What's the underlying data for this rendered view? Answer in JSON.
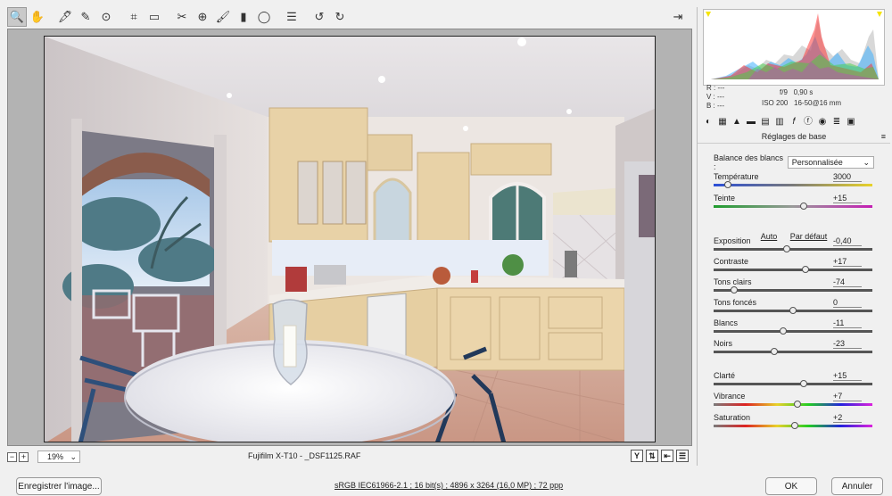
{
  "toolbar": {
    "tools": [
      {
        "name": "zoom-tool",
        "icon": "zoom-icon",
        "glyph": "🔍",
        "active": true
      },
      {
        "name": "hand-tool",
        "icon": "hand-icon",
        "glyph": "✋",
        "active": false
      },
      {
        "name": "white-balance-tool",
        "icon": "eyedropper-icon",
        "glyph": "🖋",
        "active": false
      },
      {
        "name": "color-sampler-tool",
        "icon": "color-sampler-icon",
        "glyph": "✎",
        "active": false
      },
      {
        "name": "target-adjustment-tool",
        "icon": "target-icon",
        "glyph": "⊙",
        "active": false
      },
      {
        "name": "crop-tool",
        "icon": "crop-icon",
        "glyph": "⌗",
        "active": false
      },
      {
        "name": "straighten-tool",
        "icon": "straighten-icon",
        "glyph": "▭",
        "active": false
      },
      {
        "name": "spot-removal-tool",
        "icon": "spot-removal-icon",
        "glyph": "✂",
        "active": false
      },
      {
        "name": "red-eye-tool",
        "icon": "red-eye-icon",
        "glyph": "⊕",
        "active": false
      },
      {
        "name": "adjustment-brush-tool",
        "icon": "brush-icon",
        "glyph": "🖌",
        "active": false
      },
      {
        "name": "graduated-filter-tool",
        "icon": "graduated-filter-icon",
        "glyph": "▮",
        "active": false
      },
      {
        "name": "radial-filter-tool",
        "icon": "radial-filter-icon",
        "glyph": "◯",
        "active": false
      },
      {
        "name": "preferences-tool",
        "icon": "list-icon",
        "glyph": "☰",
        "active": false
      },
      {
        "name": "rotate-left-tool",
        "icon": "rotate-left-icon",
        "glyph": "↺",
        "active": false
      },
      {
        "name": "rotate-right-tool",
        "icon": "rotate-right-icon",
        "glyph": "↻",
        "active": false
      }
    ],
    "exit_icon": "fullscreen-exit-icon",
    "exit_glyph": "⇥"
  },
  "preview": {
    "zoom": "19%",
    "filename": "Fujifilm X-T10  -  _DSF1125.RAF",
    "minus_glyph": "−",
    "plus_glyph": "+",
    "view_buttons": [
      {
        "name": "before-after-y-button",
        "glyph": "Y"
      },
      {
        "name": "before-after-swap-button",
        "glyph": "⇅"
      },
      {
        "name": "copy-settings-button",
        "glyph": "⇤"
      },
      {
        "name": "toggle-defaults-button",
        "glyph": "☰"
      }
    ]
  },
  "info": {
    "r_label": "R :",
    "r_value": "---",
    "v_label": "V :",
    "v_value": "---",
    "b_label": "B :",
    "b_value": "---",
    "aperture": "f/9",
    "shutter": "0,90 s",
    "iso": "ISO 200",
    "lens": "16-50@16 mm"
  },
  "panel": {
    "tabs": [
      "◐",
      "▦",
      "▲",
      "▬",
      "▤",
      "▥",
      "𝑓",
      "ⓕ",
      "◉",
      "≣",
      "▣"
    ],
    "title": "Réglages de base",
    "menu_glyph": "≡",
    "white_balance_label": "Balance des blancs :",
    "white_balance_value": "Personnalisée",
    "auto_label": "Auto",
    "default_label": "Par défaut",
    "sliders": [
      {
        "key": "temperature",
        "label": "Température",
        "value": "3000",
        "pos": 0.09,
        "track": "temp"
      },
      {
        "key": "tint",
        "label": "Teinte",
        "value": "+15",
        "pos": 0.57,
        "track": "tint"
      },
      {
        "key": "exposure",
        "label": "Exposition",
        "value": "-0,40",
        "pos": 0.46,
        "track": "plain"
      },
      {
        "key": "contrast",
        "label": "Contraste",
        "value": "+17",
        "pos": 0.58,
        "track": "plain"
      },
      {
        "key": "highlights",
        "label": "Tons clairs",
        "value": "-74",
        "pos": 0.13,
        "track": "plain"
      },
      {
        "key": "shadows",
        "label": "Tons foncés",
        "value": "0",
        "pos": 0.5,
        "track": "plain"
      },
      {
        "key": "whites",
        "label": "Blancs",
        "value": "-11",
        "pos": 0.44,
        "track": "plain"
      },
      {
        "key": "blacks",
        "label": "Noirs",
        "value": "-23",
        "pos": 0.38,
        "track": "plain"
      },
      {
        "key": "clarity",
        "label": "Clarté",
        "value": "+15",
        "pos": 0.57,
        "track": "plain"
      },
      {
        "key": "vibrance",
        "label": "Vibrance",
        "value": "+7",
        "pos": 0.53,
        "track": "sat"
      },
      {
        "key": "saturation",
        "label": "Saturation",
        "value": "+2",
        "pos": 0.51,
        "track": "sat"
      }
    ]
  },
  "bottom": {
    "save_label": "Enregistrer l'image...",
    "workflow_label": "sRGB IEC61966-2.1 ; 16 bit(s) ; 4896 x 3264 (16,0 MP) ; 72 ppp",
    "ok_label": "OK",
    "cancel_label": "Annuler"
  },
  "colors": {
    "panel_bg": "#f0f0f0",
    "preview_bg": "#b3b3b3",
    "clipping_warning": "#f5e400"
  }
}
